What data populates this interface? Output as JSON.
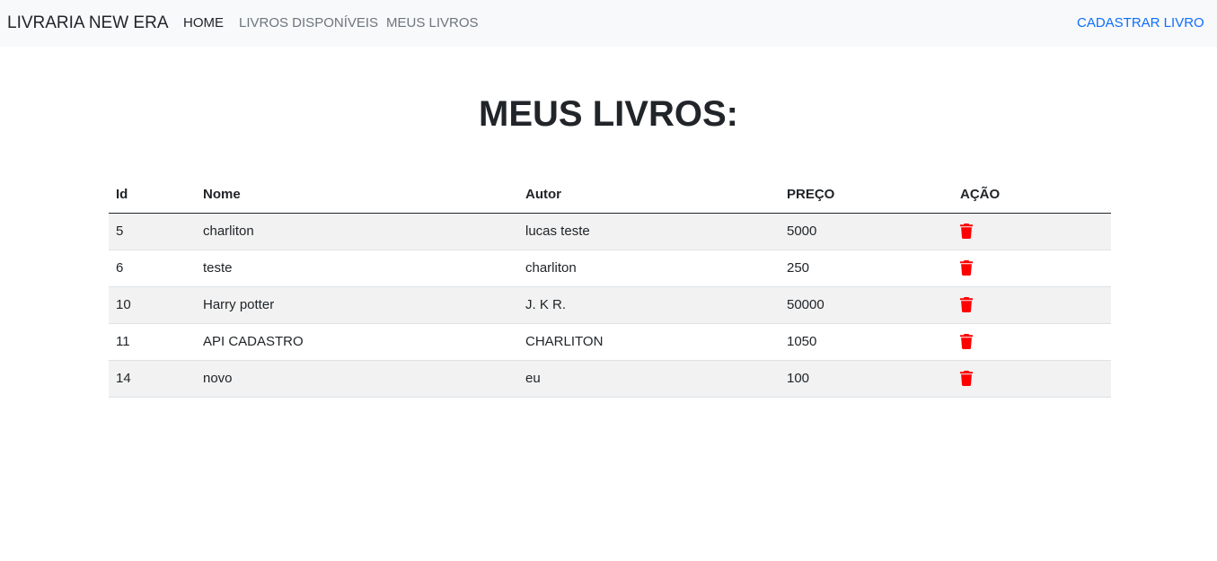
{
  "navbar": {
    "brand": "LIVRARIA NEW ERA",
    "links": [
      {
        "label": "HOME",
        "active": true
      },
      {
        "label": "LIVROS DISPONÍVEIS",
        "active": false
      },
      {
        "label": "MEUS LIVROS",
        "active": false
      }
    ],
    "cta_label": "CADASTRAR LIVRO"
  },
  "main": {
    "title": "MEUS LIVROS:",
    "table": {
      "headers": [
        "Id",
        "Nome",
        "Autor",
        "PREÇO",
        "AÇÃO"
      ],
      "rows": [
        {
          "id": "5",
          "nome": "charliton",
          "autor": "lucas teste",
          "preco": "5000",
          "action_icon": "trash-icon"
        },
        {
          "id": "6",
          "nome": "teste",
          "autor": "charliton",
          "preco": "250",
          "action_icon": "trash-icon"
        },
        {
          "id": "10",
          "nome": "Harry potter",
          "autor": "J. K R.",
          "preco": "50000",
          "action_icon": "trash-icon"
        },
        {
          "id": "11",
          "nome": "API CADASTRO",
          "autor": "CHARLITON",
          "preco": "1050",
          "action_icon": "trash-icon"
        },
        {
          "id": "14",
          "nome": "novo",
          "autor": "eu",
          "preco": "100",
          "action_icon": "trash-icon"
        }
      ]
    }
  },
  "colors": {
    "navbar_bg": "#f8f9fa",
    "link_primary": "#0d6efd",
    "delete_icon": "#ff0000",
    "striped_row": "#f2f2f2"
  }
}
